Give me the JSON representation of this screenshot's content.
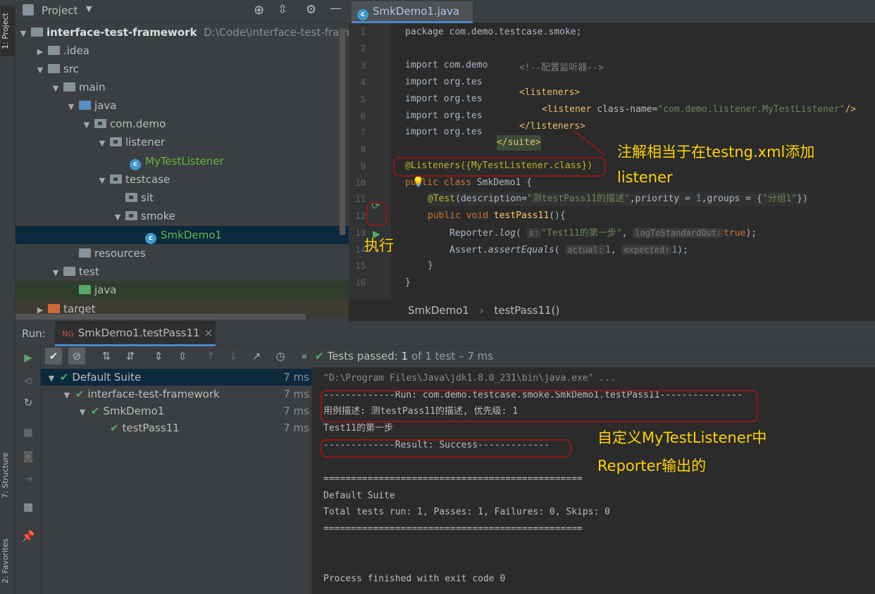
{
  "left_stripe": {
    "project": "1: Project",
    "structure": "7: Structure",
    "favorites": "2: Favorites"
  },
  "project": {
    "title": "Project",
    "root": "interface-test-framework",
    "root_path": "D:\\Code\\interface-test-framew",
    "items": [
      ".idea",
      "src",
      "main",
      "java",
      "com.demo",
      "listener",
      "MyTestListener",
      "testcase",
      "sit",
      "smoke",
      "SmkDemo1",
      "resources",
      "test",
      "java",
      "target"
    ]
  },
  "editor": {
    "tab": "SmkDemo1.java",
    "line_numbers": [
      "1",
      "2",
      "3",
      "4",
      "5",
      "6",
      "7",
      "8",
      "9",
      "10",
      "11",
      "12",
      "13",
      "14",
      "15",
      "16"
    ],
    "package_line": "package com.demo.testcase.smoke;",
    "imports": [
      "import com.demo.listener.MyTestListener;",
      "import org.tes",
      "import org.tes",
      "import org.tes",
      "import org.tes"
    ],
    "xml_comment": "<!--配置监听器-->",
    "xml_listeners_open": "<listeners>",
    "xml_listener_tag": "<listener",
    "xml_attr": "class-name=",
    "xml_val": "\"com.demo.listener.MyTestListener\"",
    "xml_close": "/>",
    "xml_listeners_close": "</listeners>",
    "xml_suite_close": "</suite>",
    "annotation": "@Listeners({MyTestListener.class})",
    "class_kw": "public class",
    "class_name": "SmkDemo1 {",
    "test_ann": "@Test",
    "test_desc_key": "(description=",
    "test_desc_val": "\"测testPass11的描述\"",
    "test_priority": ",priority = ",
    "priority_val": "1",
    "test_groups": ",groups = {",
    "groups_val": "\"分组1\"",
    "test_end": "})",
    "method_kw": "public void",
    "method_name": "testPass11",
    "method_end": "(){",
    "reporter": "Reporter.",
    "log_fn": "log",
    "hint_s": "s:",
    "log_str": "\"Test11的第一步\"",
    "hint_log": "logToStandardOut:",
    "log_true": "true",
    "log_end": ");",
    "assert": "Assert.",
    "assert_fn": "assertEquals",
    "hint_actual": "actual:",
    "assert_a": "1",
    "hint_expected": "expected:",
    "assert_b": "1",
    "assert_end": ");",
    "brace_inner": "}",
    "brace_outer": "}"
  },
  "breadcrumb": {
    "class": "SmkDemo1",
    "sep": "›",
    "method": "testPass11()"
  },
  "run": {
    "label": "Run:",
    "tab": "SmkDemo1.testPass11",
    "status_prefix": "Tests passed:",
    "status_count": "1",
    "status_rest": "of 1 test – 7 ms",
    "tree": [
      {
        "name": "Default Suite",
        "time": "7 ms"
      },
      {
        "name": "interface-test-framework",
        "time": "7 ms"
      },
      {
        "name": "SmkDemo1",
        "time": "7 ms"
      },
      {
        "name": "testPass11",
        "time": "7 ms"
      }
    ],
    "console": [
      "\"D:\\Program Files\\Java\\jdk1.8.0_231\\bin\\java.exe\" ...",
      "-------------Run: com.demo.testcase.smoke.SmkDemo1.testPass11---------------",
      "用例描述: 测testPass11的描述, 优先级: 1",
      "Test11的第一步",
      "-------------Result: Success-------------",
      "",
      "===============================================",
      "Default Suite",
      "Total tests run: 1, Passes: 1, Failures: 0, Skips: 0",
      "===============================================",
      "",
      "",
      "Process finished with exit code 0"
    ]
  },
  "annotations": {
    "note1_line1": "注解相当于在testng.xml添加",
    "note1_line2": "listener",
    "note2": "执行",
    "note3_line1": "自定义MyTestListener中",
    "note3_line2": "Reporter输出的"
  }
}
